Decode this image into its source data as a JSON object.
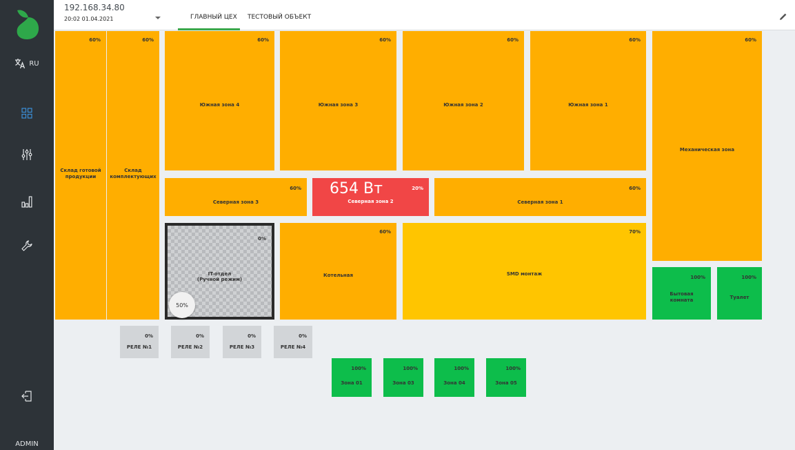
{
  "sidebar": {
    "lang": "RU",
    "user": "ADMIN"
  },
  "header": {
    "ip": "192.168.34.80",
    "datetime": "20:02 01.04.2021"
  },
  "tabs": [
    {
      "label": "ГЛАВНЫЙ ЦЕХ",
      "active": true
    },
    {
      "label": "ТЕСТОВЫЙ ОБЪЕКТ",
      "active": false
    }
  ],
  "colors": {
    "orange": "#ffae00",
    "yellow": "#ffc500",
    "red": "#f14646",
    "green": "#0dbd4b",
    "gray": "#d2d5d8",
    "active_tab": "#3aa84b"
  },
  "zones": {
    "sklad_gotovoy": {
      "label": "Склад готовой продукции",
      "pct": "60%"
    },
    "sklad_komplekt": {
      "label": "Склад комплектующих",
      "pct": "60%"
    },
    "south4": {
      "label": "Южная зона 4",
      "pct": "60%"
    },
    "south3": {
      "label": "Южная зона 3",
      "pct": "60%"
    },
    "south2": {
      "label": "Южная зона 2",
      "pct": "60%"
    },
    "south1": {
      "label": "Южная зона 1",
      "pct": "60%"
    },
    "mech": {
      "label": "Механическая зона",
      "pct": "60%"
    },
    "north3": {
      "label": "Северная зона 3",
      "pct": "60%"
    },
    "north2": {
      "label": "Северная зона 2",
      "pct": "20%",
      "power": "654 Вт"
    },
    "north1": {
      "label": "Северная зона 1",
      "pct": "60%"
    },
    "it": {
      "label1": "IT-отдел",
      "label2": "(Ручной режим)",
      "pct": "0%",
      "knob": "50%"
    },
    "boiler": {
      "label": "Котельная",
      "pct": "60%"
    },
    "smd": {
      "label": "SMD монтаж",
      "pct": "70%"
    },
    "byt": {
      "label1": "Бытовая",
      "label2": "комната",
      "pct": "100%"
    },
    "toilet": {
      "label": "Туалет",
      "pct": "100%"
    }
  },
  "relays": [
    {
      "label": "РЕЛЕ №1",
      "pct": "0%"
    },
    {
      "label": "РЕЛЕ №2",
      "pct": "0%"
    },
    {
      "label": "РЕЛЕ №3",
      "pct": "0%"
    },
    {
      "label": "РЕЛЕ №4",
      "pct": "0%"
    }
  ],
  "small_zones": [
    {
      "label": "Зона 01",
      "pct": "100%"
    },
    {
      "label": "Зона 03",
      "pct": "100%"
    },
    {
      "label": "Зона 04",
      "pct": "100%"
    },
    {
      "label": "Зона 05",
      "pct": "100%"
    }
  ]
}
